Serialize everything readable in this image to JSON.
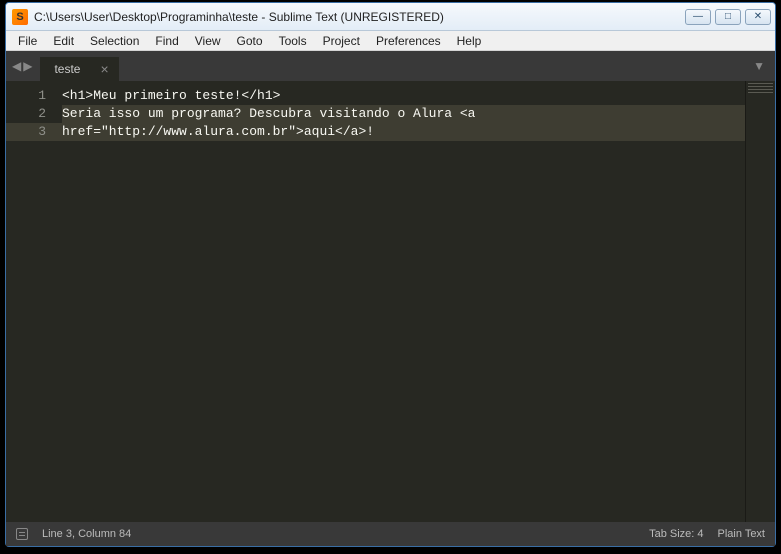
{
  "window": {
    "title": "C:\\Users\\User\\Desktop\\Programinha\\teste - Sublime Text (UNREGISTERED)"
  },
  "menu": {
    "items": [
      "File",
      "Edit",
      "Selection",
      "Find",
      "View",
      "Goto",
      "Tools",
      "Project",
      "Preferences",
      "Help"
    ]
  },
  "tabs": {
    "nav_back": "◀",
    "nav_forward": "▶",
    "active": "teste",
    "close": "×",
    "dropdown": "▼"
  },
  "gutter": {
    "l1": "1",
    "l2": "2",
    "l3": "3"
  },
  "code": {
    "line1": "<h1>Meu primeiro teste!</h1>",
    "line2": "",
    "line3a": "Seria isso um programa? Descubra visitando o Alura <a ",
    "line3b": "href=\"http://www.alura.com.br\">aqui</a>!"
  },
  "status": {
    "position": "Line 3, Column 84",
    "tab_size": "Tab Size: 4",
    "syntax": "Plain Text"
  },
  "win_controls": {
    "min": "—",
    "max": "□",
    "close": "✕"
  }
}
